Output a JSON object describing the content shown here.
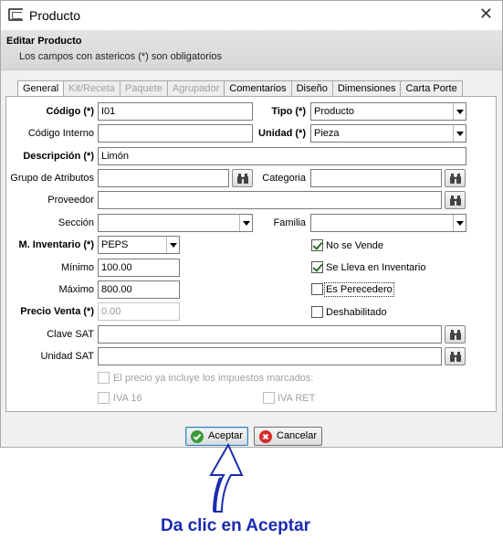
{
  "window": {
    "title": "Producto"
  },
  "header": {
    "title": "Editar Producto",
    "subtitle": "Los campos con astericos (*) son obligatorios"
  },
  "tabs": [
    {
      "label": "General",
      "state": "active"
    },
    {
      "label": "Kit/Receta",
      "state": "disabled"
    },
    {
      "label": "Paquete",
      "state": "disabled"
    },
    {
      "label": "Agrupador",
      "state": "disabled"
    },
    {
      "label": "Comentarios",
      "state": "enabled"
    },
    {
      "label": "Diseño",
      "state": "enabled"
    },
    {
      "label": "Dimensiones",
      "state": "enabled"
    },
    {
      "label": "Carta Porte",
      "state": "enabled"
    }
  ],
  "form": {
    "codigo": {
      "label": "Código (*)",
      "value": "I01"
    },
    "tipo": {
      "label": "Tipo (*)",
      "value": "Producto"
    },
    "codigo_interno": {
      "label": "Código Interno",
      "value": ""
    },
    "unidad": {
      "label": "Unidad (*)",
      "value": "Pieza"
    },
    "descripcion": {
      "label": "Descripción (*)",
      "value": "Limón"
    },
    "grupo_atributos": {
      "label": "Grupo de Atributos",
      "value": ""
    },
    "categoria": {
      "label": "Categoria",
      "value": ""
    },
    "proveedor": {
      "label": "Proveedor",
      "value": ""
    },
    "seccion": {
      "label": "Sección",
      "value": ""
    },
    "familia": {
      "label": "Familia",
      "value": ""
    },
    "m_inventario": {
      "label": "M. Inventario (*)",
      "value": "PEPS"
    },
    "minimo": {
      "label": "Mínimo",
      "value": "100.00"
    },
    "maximo": {
      "label": "Máximo",
      "value": "800.00"
    },
    "precio_venta": {
      "label": "Precio Venta (*)",
      "value": "0.00"
    },
    "clave_sat": {
      "label": "Clave SAT",
      "value": ""
    },
    "unidad_sat": {
      "label": "Unidad SAT",
      "value": ""
    }
  },
  "checks": {
    "no_se_vende": {
      "label": "No se Vende",
      "checked": true
    },
    "se_lleva_inventario": {
      "label": "Se Lleva en Inventario",
      "checked": true
    },
    "es_perecedero": {
      "label": "Es Perecedero",
      "checked": false
    },
    "deshabilitado": {
      "label": "Deshabilitado",
      "checked": false
    },
    "precio_incluye": {
      "label": "El precio ya incluye los impuestos marcados:",
      "checked": false
    },
    "iva16": {
      "label": "IVA 16",
      "checked": false
    },
    "iva_ret": {
      "label": "IVA RET",
      "checked": false
    }
  },
  "buttons": {
    "accept": "Aceptar",
    "cancel": "Cancelar"
  },
  "annotation": {
    "text": "Da clic en Aceptar"
  },
  "colors": {
    "accent": "#1b2bb0",
    "accept_icon": "#3a9a3a",
    "cancel_icon": "#d62b2b"
  }
}
